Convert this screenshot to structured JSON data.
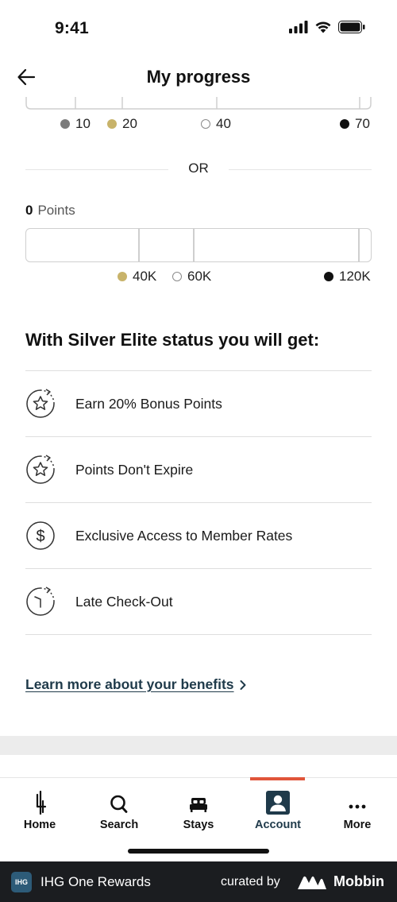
{
  "status": {
    "time": "9:41"
  },
  "nav": {
    "title": "My progress"
  },
  "nights_scale": [
    {
      "value": "10",
      "color": "#7b7b7b",
      "hollow": false
    },
    {
      "value": "20",
      "color": "#c8b36a",
      "hollow": false
    },
    {
      "value": "40",
      "color": "#ffffff",
      "hollow": true
    },
    {
      "value": "70",
      "color": "#111111",
      "hollow": false
    }
  ],
  "divider": {
    "text": "OR"
  },
  "points": {
    "value": "0",
    "unit": "Points",
    "progress": 0,
    "scale": [
      {
        "value": "40K",
        "color": "#c8b36a",
        "hollow": false
      },
      {
        "value": "60K",
        "color": "#ffffff",
        "hollow": true
      },
      {
        "value": "120K",
        "color": "#111111",
        "hollow": false
      }
    ]
  },
  "benefits": {
    "heading": "With Silver Elite status you will get:",
    "items": [
      {
        "label": "Earn 20% Bonus Points",
        "icon": "star-refresh-icon"
      },
      {
        "label": "Points Don't Expire",
        "icon": "star-refresh-icon"
      },
      {
        "label": "Exclusive Access to Member Rates",
        "icon": "dollar-circle-icon"
      },
      {
        "label": "Late Check-Out",
        "icon": "clock-icon"
      }
    ]
  },
  "learn_more": {
    "label": "Learn more about your benefits"
  },
  "tabs": [
    {
      "label": "Home",
      "icon": "ihg-logo-icon"
    },
    {
      "label": "Search",
      "icon": "search-icon"
    },
    {
      "label": "Stays",
      "icon": "bed-icon"
    },
    {
      "label": "Account",
      "icon": "account-icon",
      "active": true
    },
    {
      "label": "More",
      "icon": "more-icon"
    }
  ],
  "footer": {
    "logo": "IHG",
    "app_name": "IHG One Rewards",
    "curated_by": "curated by",
    "brand": "Mobbin"
  },
  "colors": {
    "accent": "#1f3a4a",
    "tab_indicator": "#e0553a",
    "gold": "#c8b36a",
    "silver": "#ffffff",
    "black": "#111111",
    "grey": "#7b7b7b"
  }
}
